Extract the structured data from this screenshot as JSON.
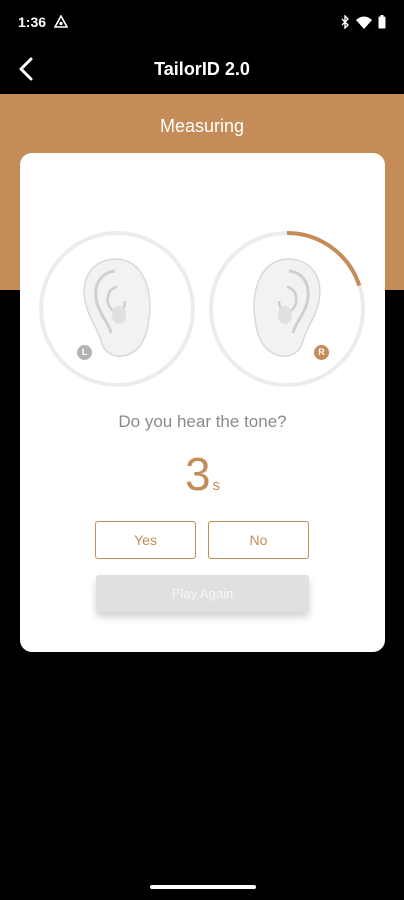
{
  "status_bar": {
    "time": "1:36"
  },
  "app_bar": {
    "title": "TailorID 2.0"
  },
  "header": {
    "title": "Measuring"
  },
  "ears": {
    "left": {
      "badge": "L"
    },
    "right": {
      "badge": "R",
      "progress": 0.2
    }
  },
  "question": "Do you hear the tone?",
  "countdown": {
    "value": "3",
    "unit": "s"
  },
  "buttons": {
    "yes": "Yes",
    "no": "No",
    "play_again": "Play Again"
  },
  "colors": {
    "accent": "#c48c58",
    "badge_inactive": "#b3b3b3",
    "disabled": "#e0e0e0"
  }
}
